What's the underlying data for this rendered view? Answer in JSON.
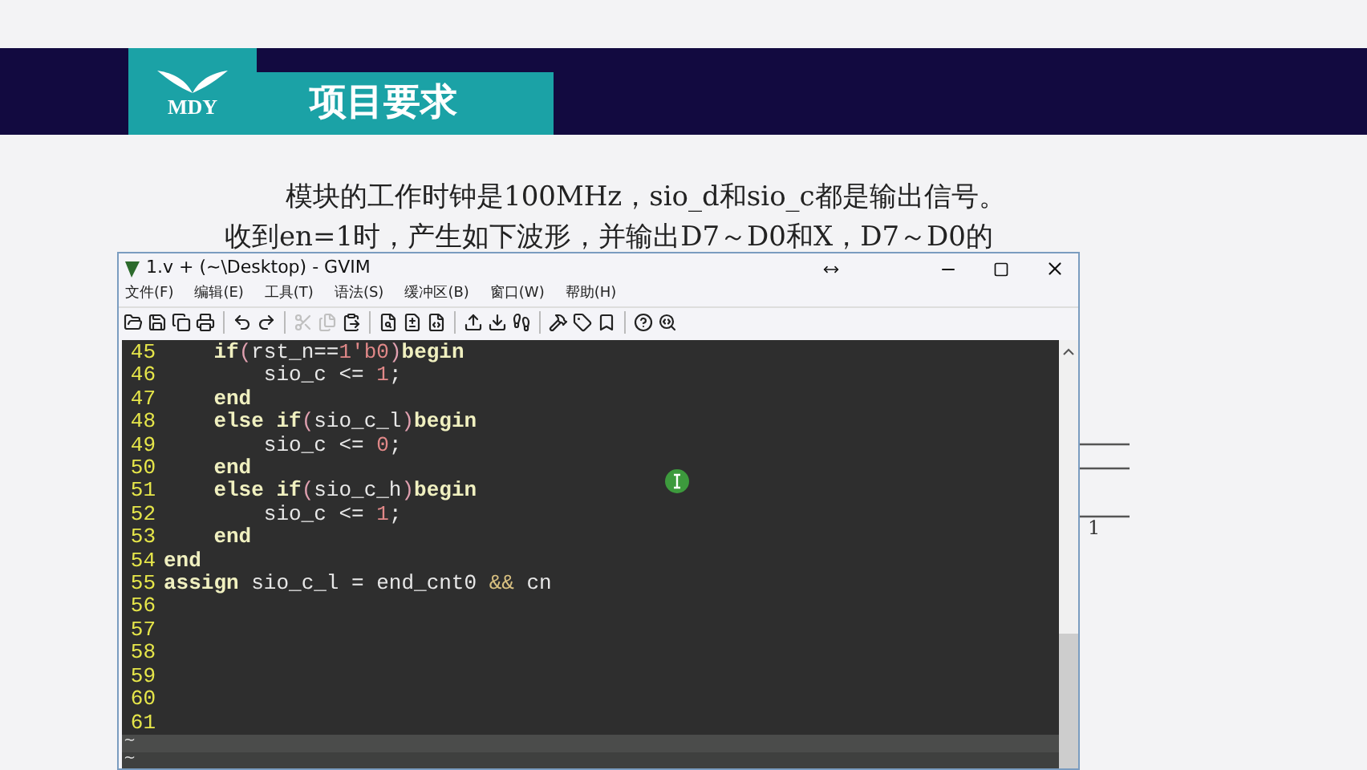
{
  "slide": {
    "logo_text": "MDY",
    "title": "项目要求",
    "paragraph_lines": [
      "模块的工作时钟是100MHz，sio_d和sio_c都是输出信号。",
      "收到en=1时，产生如下波形，并输出D7～D0和X，D7～D0的"
    ],
    "waveform_label": "1"
  },
  "window": {
    "title": "1.v + (~\\Desktop) - GVIM",
    "menu": [
      "文件(F)",
      "编辑(E)",
      "工具(T)",
      "语法(S)",
      "缓冲区(B)",
      "窗口(W)",
      "帮助(H)"
    ],
    "toolbar_buttons": [
      {
        "disabled": false
      },
      {
        "disabled": false
      },
      {
        "disabled": false
      },
      {
        "disabled": false
      },
      {
        "disabled": false
      },
      {
        "disabled": false
      },
      {
        "disabled": true
      },
      {
        "disabled": true
      },
      {
        "disabled": false
      },
      {
        "disabled": false
      },
      {
        "disabled": false
      },
      {
        "disabled": false
      },
      {
        "disabled": false
      },
      {
        "disabled": false
      },
      {
        "disabled": false
      },
      {
        "disabled": false
      },
      {
        "disabled": false
      },
      {
        "disabled": false
      },
      {
        "disabled": false
      },
      {
        "disabled": false
      }
    ],
    "lines": [
      {
        "number": "45",
        "kind": "block",
        "tokens": [
          {
            "kind": "keyword",
            "text": "if"
          },
          {
            "kind": "paren",
            "text": "("
          },
          {
            "kind": "plain",
            "text": "rst_n=="
          },
          {
            "kind": "number",
            "text": "1'b0"
          },
          {
            "kind": "paren",
            "text": ")"
          },
          {
            "kind": "keyword",
            "text": "begin"
          }
        ]
      },
      {
        "number": "46",
        "kind": "statement",
        "tokens": [
          {
            "kind": "plain",
            "text": "sio_c <= "
          },
          {
            "kind": "number",
            "text": "1"
          },
          {
            "kind": "plain",
            "text": ";"
          }
        ]
      },
      {
        "number": "47",
        "kind": "block",
        "tokens": [
          {
            "kind": "keyword",
            "text": "end"
          }
        ]
      },
      {
        "number": "48",
        "kind": "block",
        "tokens": [
          {
            "kind": "keyword",
            "text": "else if"
          },
          {
            "kind": "paren",
            "text": "("
          },
          {
            "kind": "plain",
            "text": "sio_c_l"
          },
          {
            "kind": "paren",
            "text": ")"
          },
          {
            "kind": "keyword",
            "text": "begin"
          }
        ]
      },
      {
        "number": "49",
        "kind": "statement",
        "tokens": [
          {
            "kind": "plain",
            "text": "sio_c <= "
          },
          {
            "kind": "number",
            "text": "0"
          },
          {
            "kind": "plain",
            "text": ";"
          }
        ]
      },
      {
        "number": "50",
        "kind": "block",
        "tokens": [
          {
            "kind": "keyword",
            "text": "end"
          }
        ]
      },
      {
        "number": "51",
        "kind": "block",
        "tokens": [
          {
            "kind": "keyword",
            "text": "else if"
          },
          {
            "kind": "paren",
            "text": "("
          },
          {
            "kind": "plain",
            "text": "sio_c_h"
          },
          {
            "kind": "paren",
            "text": ")"
          },
          {
            "kind": "keyword",
            "text": "begin"
          }
        ]
      },
      {
        "number": "52",
        "kind": "statement",
        "tokens": [
          {
            "kind": "plain",
            "text": "sio_c <= "
          },
          {
            "kind": "number",
            "text": "1"
          },
          {
            "kind": "plain",
            "text": ";"
          }
        ]
      },
      {
        "number": "53",
        "kind": "block",
        "tokens": [
          {
            "kind": "keyword",
            "text": "end"
          }
        ]
      },
      {
        "number": "54",
        "kind": "top",
        "tokens": [
          {
            "kind": "keyword",
            "text": "end"
          }
        ]
      },
      {
        "number": "55",
        "kind": "top",
        "tokens": [
          {
            "kind": "keyword",
            "text": "assign"
          },
          {
            "kind": "plain",
            "text": " sio_c_l = end_cnt0 "
          },
          {
            "kind": "operator",
            "text": "&&"
          },
          {
            "kind": "plain",
            "text": " cn"
          }
        ]
      },
      {
        "number": "56"
      },
      {
        "number": "57"
      },
      {
        "number": "58"
      },
      {
        "number": "59"
      },
      {
        "number": "60"
      },
      {
        "number": "61"
      }
    ],
    "tilde_rows": [
      "~",
      "~"
    ]
  }
}
